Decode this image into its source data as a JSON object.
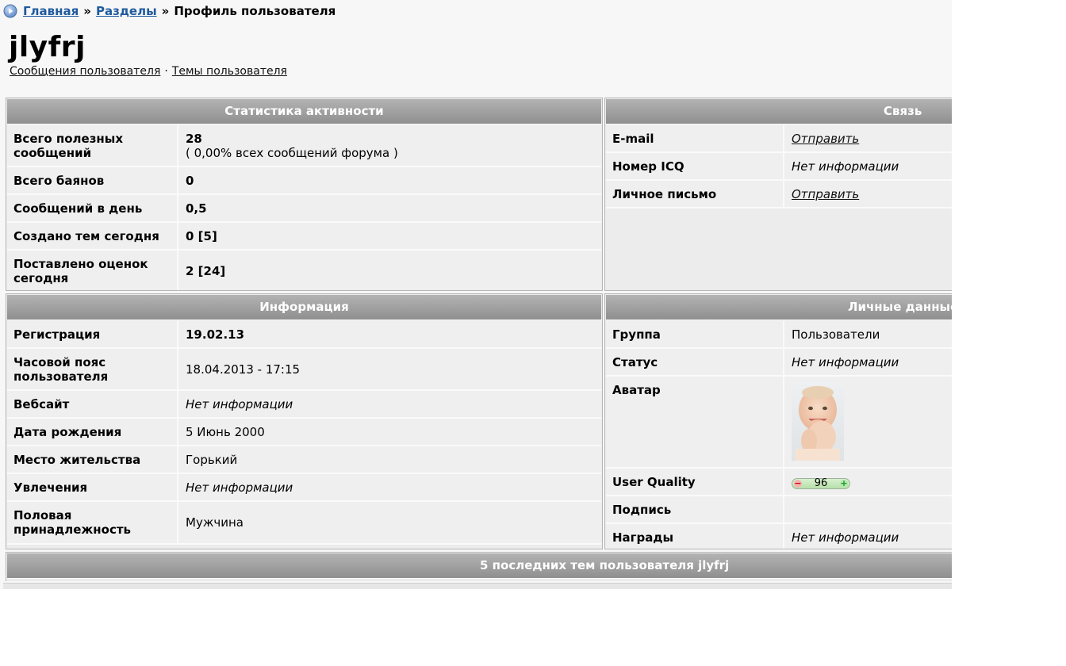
{
  "breadcrumb": {
    "home": "Главная",
    "separator": "»",
    "sections": "Разделы",
    "current": "Профиль пользователя"
  },
  "user": {
    "name": "jlyfrj",
    "links": {
      "messages": "Сообщения пользователя",
      "dot": "·",
      "topics": "Темы пользователя"
    }
  },
  "stats": {
    "title": "Статистика активности",
    "rows": [
      {
        "label": "Всего полезных сообщений",
        "value": "28",
        "sub": "( 0,00% всех сообщений форума )"
      },
      {
        "label": "Всего баянов",
        "value": "0"
      },
      {
        "label": "Сообщений в день",
        "value": "0,5"
      },
      {
        "label": "Создано тем сегодня",
        "value": "0 [5]"
      },
      {
        "label": "Поставлено оценок сегодня",
        "value": "2 [24]"
      }
    ]
  },
  "contact": {
    "title": "Связь",
    "rows": [
      {
        "label": "E-mail",
        "value": "Отправить"
      },
      {
        "label": "Номер ICQ",
        "value": "Нет информации"
      },
      {
        "label": "Личное письмо",
        "value": "Отправить"
      }
    ]
  },
  "info": {
    "title": "Информация",
    "rows": [
      {
        "label": "Регистрация",
        "value": "19.02.13"
      },
      {
        "label": "Часовой пояс пользователя",
        "value": "18.04.2013 - 17:15"
      },
      {
        "label": "Вебсайт",
        "value": "Нет информации"
      },
      {
        "label": "Дата рождения",
        "value": "5 Июнь 2000"
      },
      {
        "label": "Место жительства",
        "value": "Горький"
      },
      {
        "label": "Увлечения",
        "value": "Нет информации"
      },
      {
        "label": "Половая принадлежность",
        "value": "Мужчина"
      }
    ]
  },
  "personal": {
    "title": "Личные данные",
    "rows": [
      {
        "label": "Группа",
        "value": "Пользователи"
      },
      {
        "label": "Статус",
        "value": "Нет информации"
      },
      {
        "label": "Аватар",
        "value": ""
      },
      {
        "label": "User Quality",
        "value": "96",
        "minus": "−",
        "plus": "+"
      },
      {
        "label": "Подпись",
        "value": ""
      },
      {
        "label": "Награды",
        "value": "Нет информации"
      }
    ]
  },
  "recent": {
    "title": "5 последних тем пользователя jlyfrj"
  },
  "colors": {
    "link": "#1f5a9e",
    "header_gradient_top": "#b3b3b3",
    "header_gradient_bottom": "#8f8f8f",
    "panel_bg": "#ececec",
    "page_bg": "#f7f7f7"
  }
}
